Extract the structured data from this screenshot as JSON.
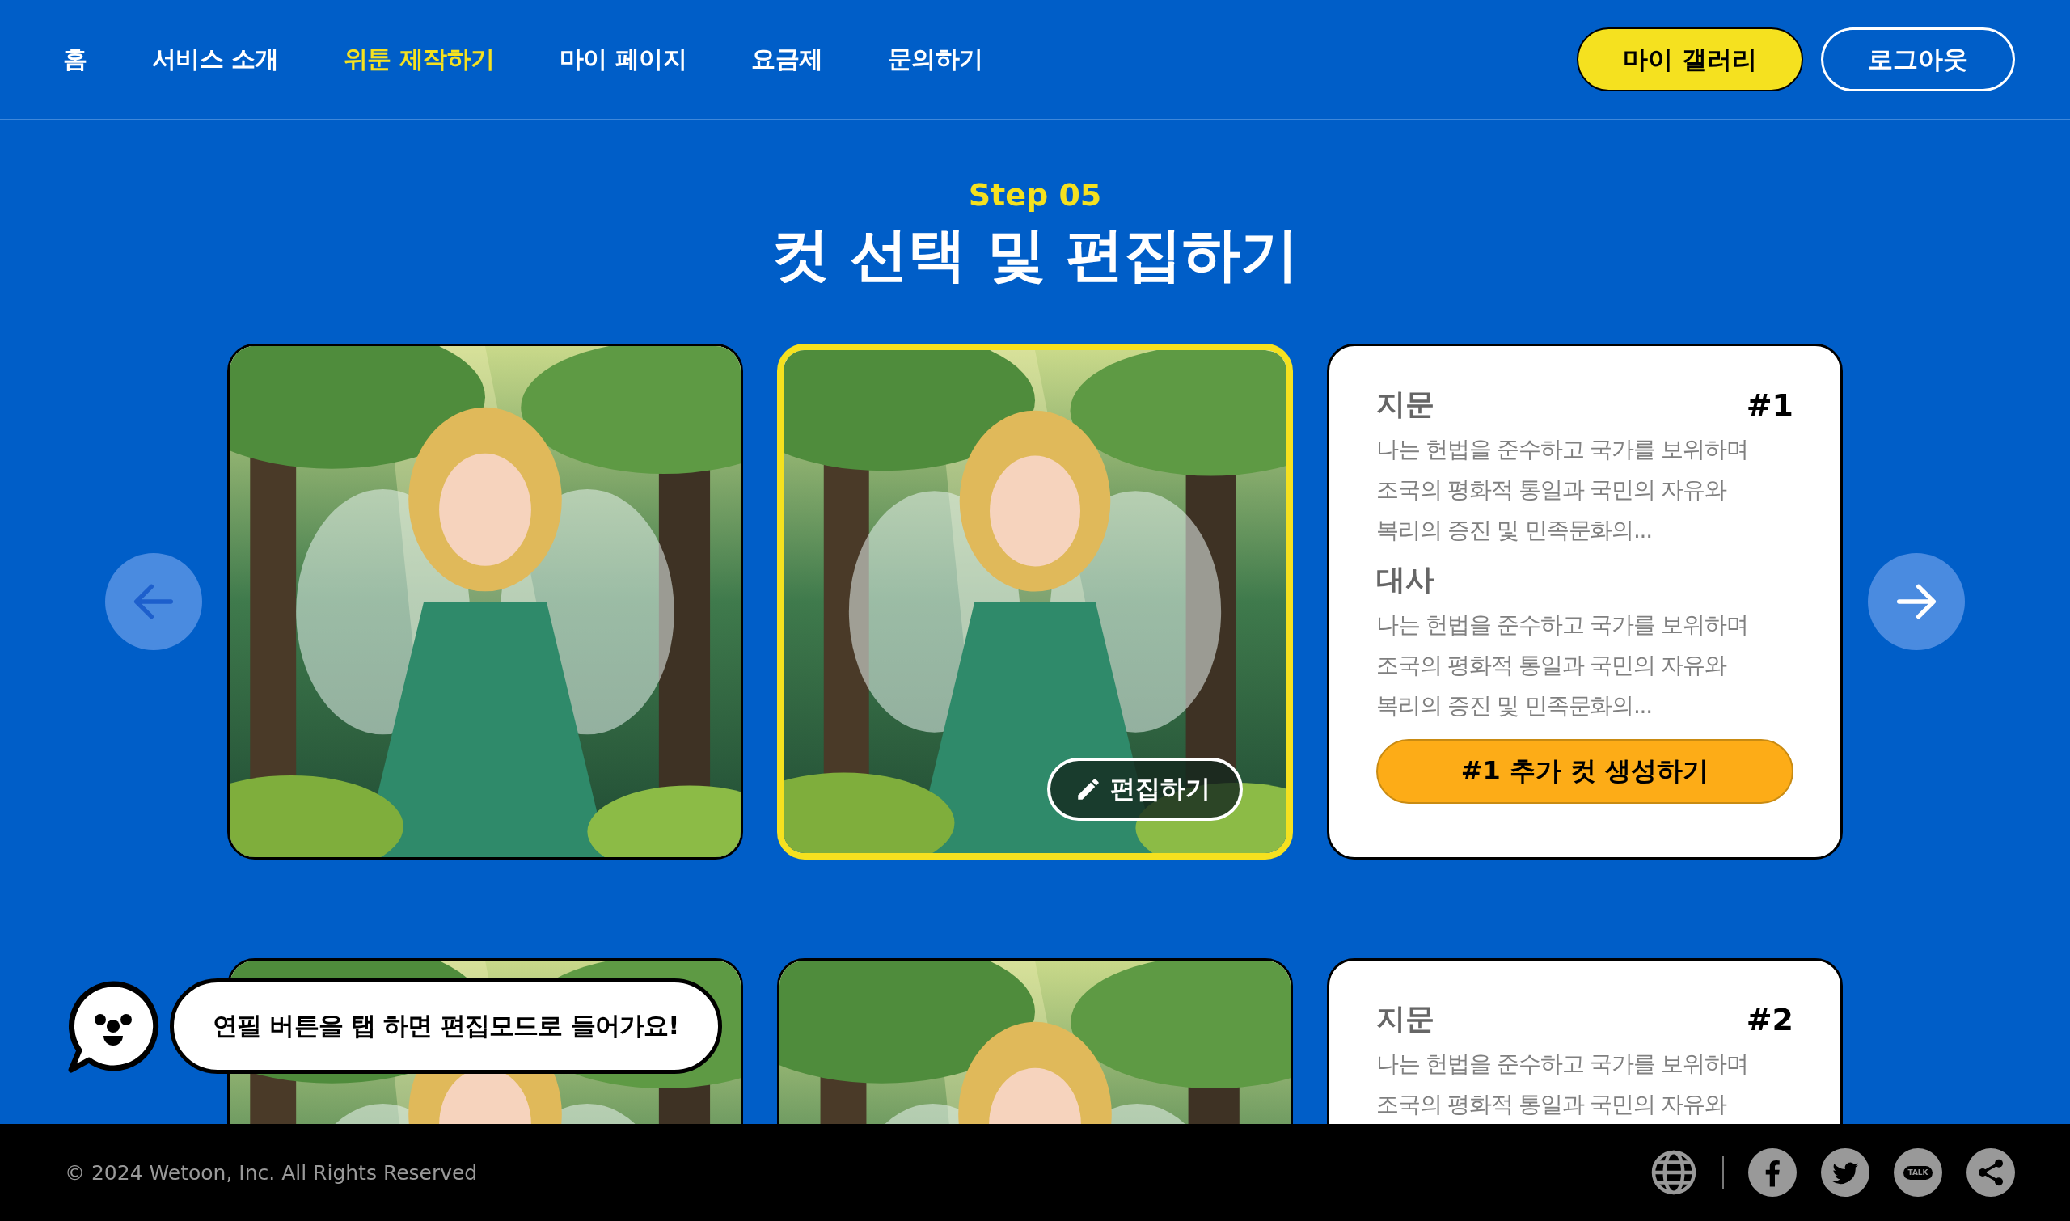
{
  "nav": {
    "items": [
      {
        "label": "홈",
        "selected": false
      },
      {
        "label": "서비스 소개",
        "selected": false
      },
      {
        "label": "위툰 제작하기",
        "selected": true
      },
      {
        "label": "마이 페이지",
        "selected": false
      },
      {
        "label": "요금제",
        "selected": false
      },
      {
        "label": "문의하기",
        "selected": false
      }
    ],
    "buttons": [
      {
        "label": "마이 갤러리",
        "kind": "primary"
      },
      {
        "label": "로그아웃",
        "kind": "outline"
      }
    ]
  },
  "heading": {
    "step": "Step 05",
    "title": "컷 선택 및 편집하기"
  },
  "carousel": {
    "prev": {
      "disabled": true
    },
    "next": {
      "disabled": false
    },
    "rows": [
      {
        "cards": [
          {
            "kind": "picture",
            "selected": false
          },
          {
            "kind": "picture",
            "selected": true,
            "edit_button": "편집하기"
          },
          {
            "kind": "text",
            "number": "#1",
            "sections": [
              {
                "heading": "지문",
                "body": "나는 헌법을 준수하고 국가를 보위하며\n조국의 평화적 통일과 국민의 자유와\n복리의 증진 및 민족문화의..."
              },
              {
                "heading": "대사",
                "body": "나는 헌법을 준수하고 국가를 보위하며\n조국의 평화적 통일과 국민의 자유와\n복리의 증진 및 민족문화의..."
              }
            ],
            "button": "#1 추가 컷 생성하기"
          }
        ]
      },
      {
        "cards": [
          {
            "kind": "picture",
            "selected": false
          },
          {
            "kind": "picture",
            "selected": false
          },
          {
            "kind": "text",
            "number": "#2",
            "sections": [
              {
                "heading": "지문",
                "body": "나는 헌법을 준수하고 국가를 보위하며\n조국의 평화적 통일과 국민의 자유와"
              }
            ]
          }
        ]
      }
    ]
  },
  "tip": {
    "text": "연필 버튼을 탭 하면 편집모드로 들어가요!"
  },
  "footer": {
    "copyright": "© 2024 Wetoon, Inc. All Rights Reserved",
    "talk_label": "TALK"
  }
}
